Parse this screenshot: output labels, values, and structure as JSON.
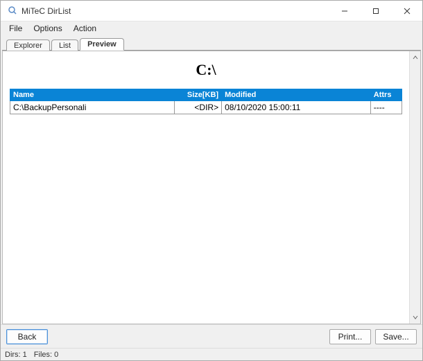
{
  "window": {
    "title": "MiTeC DirList"
  },
  "menu": {
    "file": "File",
    "options": "Options",
    "action": "Action"
  },
  "tabs": {
    "explorer": "Explorer",
    "list": "List",
    "preview": "Preview",
    "active": "preview"
  },
  "preview": {
    "path_title": "C:\\",
    "columns": {
      "name": "Name",
      "size": "Size[KB]",
      "modified": "Modified",
      "attrs": "Attrs"
    },
    "rows": [
      {
        "name": "C:\\BackupPersonali",
        "size": "<DIR>",
        "modified": "08/10/2020 15:00:11",
        "attrs": "----"
      }
    ]
  },
  "buttons": {
    "back": "Back",
    "print": "Print...",
    "save": "Save..."
  },
  "status": {
    "dirs_label": "Dirs:",
    "dirs_count": "1",
    "files_label": "Files:",
    "files_count": "0"
  }
}
